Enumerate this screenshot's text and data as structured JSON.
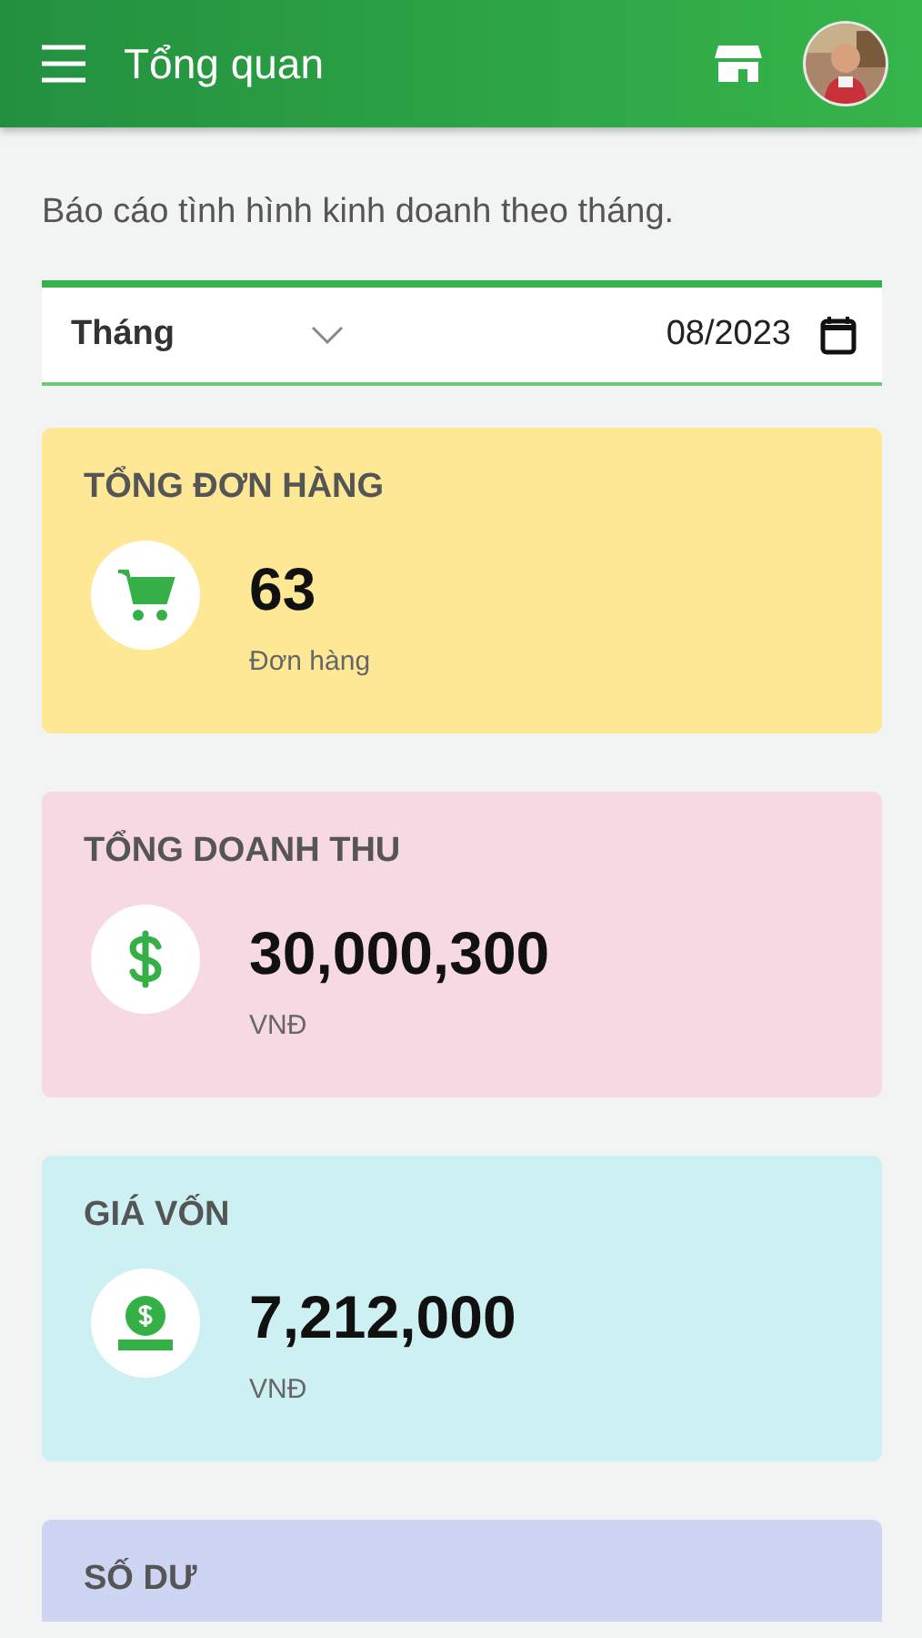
{
  "app_bar": {
    "title": "Tổng quan"
  },
  "subtitle": "Báo cáo tình hình kinh doanh theo tháng.",
  "filter": {
    "period": "Tháng",
    "date": "08/2023"
  },
  "cards": [
    {
      "title": "TỔNG ĐƠN HÀNG",
      "kind": "cart",
      "color": "#fee795",
      "value": "63",
      "unit": "Đơn hàng"
    },
    {
      "title": "TỔNG DOANH THU",
      "kind": "dollar",
      "color": "#f7d9e3",
      "value": "30,000,300",
      "unit": "VNĐ"
    },
    {
      "title": "GIÁ VỐN",
      "kind": "coin",
      "color": "#cdf0f3",
      "value": "7,212,000",
      "unit": "VNĐ"
    },
    {
      "title": "SỐ DƯ",
      "color": "#cdd5f3"
    }
  ]
}
